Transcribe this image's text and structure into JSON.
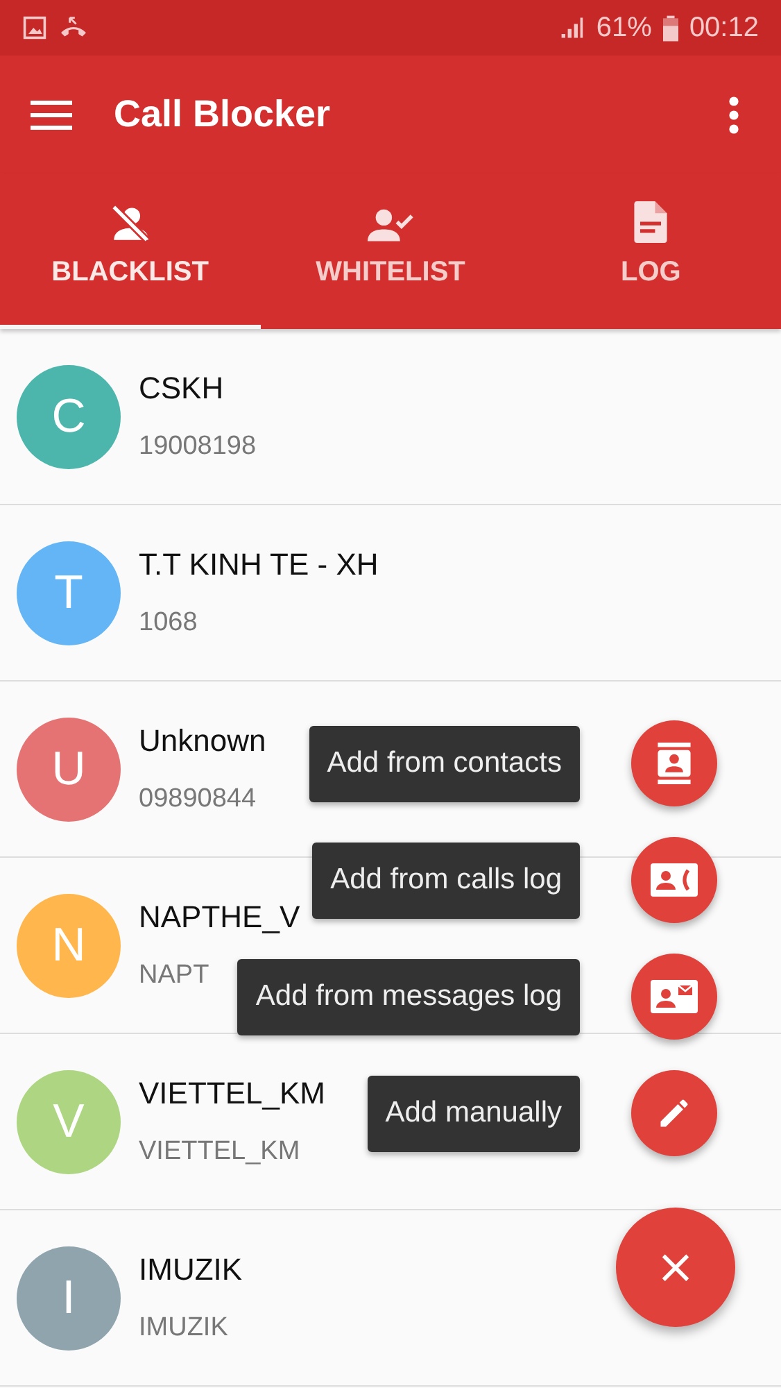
{
  "status_bar": {
    "battery": "61%",
    "time": "00:12"
  },
  "toolbar": {
    "title": "Call Blocker"
  },
  "tabs": [
    {
      "label": "BLACKLIST",
      "kind": "blocked",
      "selected": true
    },
    {
      "label": "WHITELIST",
      "kind": "allowed",
      "selected": false
    },
    {
      "label": "LOG",
      "kind": "log",
      "selected": false
    }
  ],
  "contacts": [
    {
      "initial": "C",
      "name": "CSKH",
      "number": "19008198",
      "color": "#4db6ac"
    },
    {
      "initial": "T",
      "name": "T.T KINH TE - XH",
      "number": "1068",
      "color": "#64b5f6"
    },
    {
      "initial": "U",
      "name": "Unknown",
      "number": "09890844",
      "color": "#e57373"
    },
    {
      "initial": "N",
      "name": "NAPTHE_V",
      "number": "NAPT",
      "color": "#ffb74d"
    },
    {
      "initial": "V",
      "name": "VIETTEL_KM",
      "number": "VIETTEL_KM",
      "color": "#aed581"
    },
    {
      "initial": "I",
      "name": "IMUZIK",
      "number": "IMUZIK",
      "color": "#90a4ae"
    }
  ],
  "speed_dial": {
    "actions": [
      {
        "label": "Add from contacts",
        "kind": "contacts"
      },
      {
        "label": "Add from calls log",
        "kind": "calls"
      },
      {
        "label": "Add from messages log",
        "kind": "messages"
      },
      {
        "label": "Add manually",
        "kind": "manual"
      }
    ],
    "close_label": "×"
  }
}
